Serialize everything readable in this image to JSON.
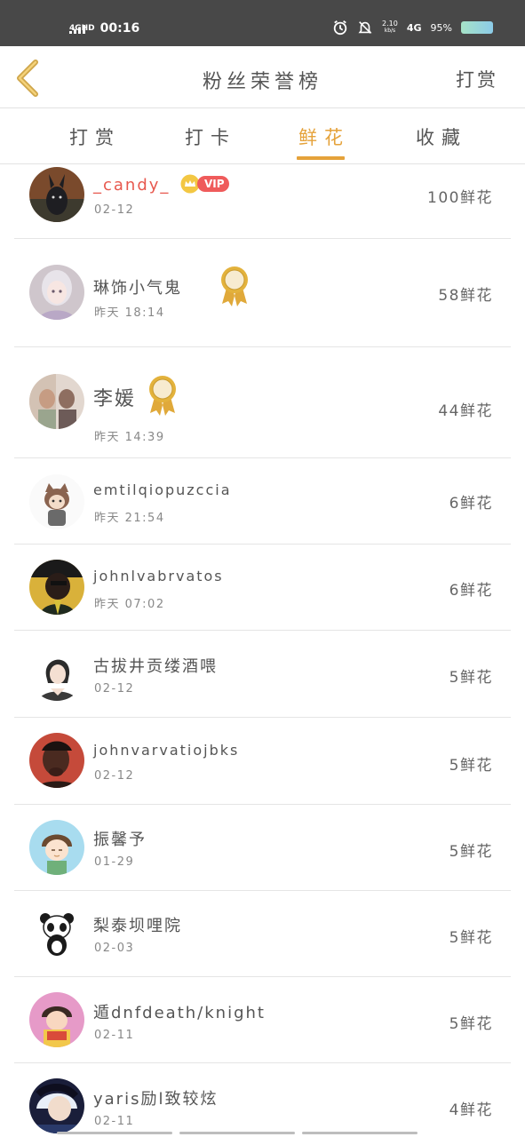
{
  "status_bar": {
    "network_tag": "4GHD",
    "time": "00:16",
    "speed_value": "2.10",
    "speed_unit": "kb/s",
    "network": "4G",
    "battery_percent": "95%",
    "icons": [
      "signal-icon",
      "alarm-icon",
      "mute-icon",
      "battery-icon"
    ]
  },
  "header": {
    "title": "粉丝荣誉榜",
    "right_action": "打赏",
    "back_icon": "back-chevron-icon"
  },
  "tabs": {
    "items": [
      {
        "label": "打赏"
      },
      {
        "label": "打卡"
      },
      {
        "label": "鲜花"
      },
      {
        "label": "收藏"
      }
    ],
    "active_index": 2,
    "accent_color": "#e5a23a"
  },
  "fans": [
    {
      "name": "_candy_",
      "time": "02-12",
      "count": "100鲜花",
      "badge": "VIP",
      "badge_icon": "crown-icon"
    },
    {
      "name": "琳饰小气鬼",
      "time": "昨天 18:14",
      "count": "58鲜花",
      "badge_icon": "medal-icon"
    },
    {
      "name": "李媛",
      "time": "昨天 14:39",
      "count": "44鲜花",
      "badge_icon": "medal-icon"
    },
    {
      "name": "emtilqiopuzccia",
      "time": "昨天 21:54",
      "count": "6鲜花"
    },
    {
      "name": "johnlvabrvatos",
      "time": "昨天 07:02",
      "count": "6鲜花"
    },
    {
      "name": "古拔井贡缕酒喂",
      "time": "02-12",
      "count": "5鲜花"
    },
    {
      "name": "johnvarvatiojbks",
      "time": "02-12",
      "count": "5鲜花"
    },
    {
      "name": "振馨予",
      "time": "01-29",
      "count": "5鲜花"
    },
    {
      "name": "梨泰坝哩院",
      "time": "02-03",
      "count": "5鲜花"
    },
    {
      "name": "遁dnfdeath/knight",
      "time": "02-11",
      "count": "5鲜花"
    },
    {
      "name": "yaris励l致较炫",
      "time": "02-11",
      "count": "4鲜花"
    }
  ],
  "colors": {
    "status_bar": "#484848",
    "vip_name": "#e7584e",
    "vip_pill": "#ef5b5b",
    "medal": "#e3b23c"
  }
}
